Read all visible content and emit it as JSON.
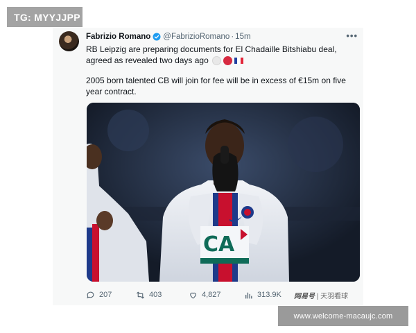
{
  "watermark": {
    "text": "TG: MYYJJPP"
  },
  "tweet": {
    "author_name": "Fabrizio Romano",
    "handle": "@FabrizioRomano",
    "separator": "·",
    "time": "15m",
    "more_label": "•••",
    "text_line1": "RB Leipzig are preparing documents for  El Chadaille Bitshiabu deal, agreed as revealed two days ago",
    "text_para2": "2005 born talented CB will join for fee will be in excess of €15m on five year contract.",
    "emojis": [
      "white-circle",
      "red-circle",
      "france-flag"
    ],
    "media": {
      "description_icon": "player-photo-image",
      "shirt_text": "CA"
    },
    "actions": {
      "replies": "207",
      "retweets": "403",
      "likes": "4,827",
      "views": "313.9K"
    },
    "source_mark": {
      "brand": "网易号",
      "name": "天羽看球"
    }
  },
  "site_banner": {
    "text": "www.welcome-macaujc.com"
  },
  "colors": {
    "verified": "#1d9bf0",
    "text_primary": "#0f1419",
    "text_secondary": "#536471",
    "badge_bg": "#a3a3a3",
    "banner_bg": "#9a9a9a"
  }
}
